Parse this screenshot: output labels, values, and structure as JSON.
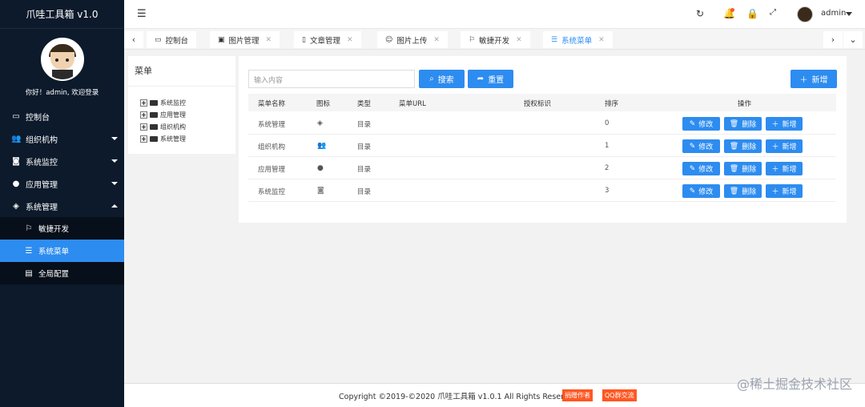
{
  "sidebar": {
    "brand": "爪哇工具箱 v1.0",
    "welcome": "你好！admin, 欢迎登录",
    "items": [
      {
        "label": "控制台",
        "icon": "monitor-icon"
      },
      {
        "label": "组织机构",
        "icon": "users-icon"
      },
      {
        "label": "系统监控",
        "icon": "camera-icon"
      },
      {
        "label": "应用管理",
        "icon": "compass-icon"
      },
      {
        "label": "系统管理",
        "icon": "layers-icon"
      }
    ],
    "sub_items": [
      {
        "label": "敏捷开发",
        "icon": "flag-icon"
      },
      {
        "label": "系统菜单",
        "icon": "list-icon"
      },
      {
        "label": "全局配置",
        "icon": "settings-icon"
      }
    ]
  },
  "header": {
    "username": "admin"
  },
  "tabs": [
    {
      "label": "控制台"
    },
    {
      "label": "图片管理"
    },
    {
      "label": "文章管理"
    },
    {
      "label": "图片上传"
    },
    {
      "label": "敏捷开发"
    },
    {
      "label": "系统菜单"
    }
  ],
  "left_panel": {
    "title": "菜单",
    "tree": [
      "系统监控",
      "应用管理",
      "组织机构",
      "系统管理"
    ]
  },
  "toolbar": {
    "search_placeholder": "输入内容",
    "search_label": "搜索",
    "reset_label": "重置",
    "add_label": "新增"
  },
  "table": {
    "headers": [
      "菜单名称",
      "图标",
      "类型",
      "菜单URL",
      "授权标识",
      "排序",
      "操作"
    ],
    "rows": [
      {
        "name": "系统管理",
        "type": "目录",
        "order": "0"
      },
      {
        "name": "组织机构",
        "type": "目录",
        "order": "1"
      },
      {
        "name": "应用管理",
        "type": "目录",
        "order": "2"
      },
      {
        "name": "系统监控",
        "type": "目录",
        "order": "3"
      }
    ],
    "edit_label": "修改",
    "delete_label": "删除",
    "add_label": "新增"
  },
  "footer": {
    "copyright": "Copyright ©2019-©2020 爪哇工具箱 v1.0.1 All Rights Reserved",
    "donate": "捐赠作者",
    "qq": "QQ群交流"
  },
  "watermark": "@稀土掘金技术社区",
  "colors": {
    "primary": "#2d8cf0",
    "sidebar": "#0c1a2b",
    "badge": "#ff5722"
  }
}
